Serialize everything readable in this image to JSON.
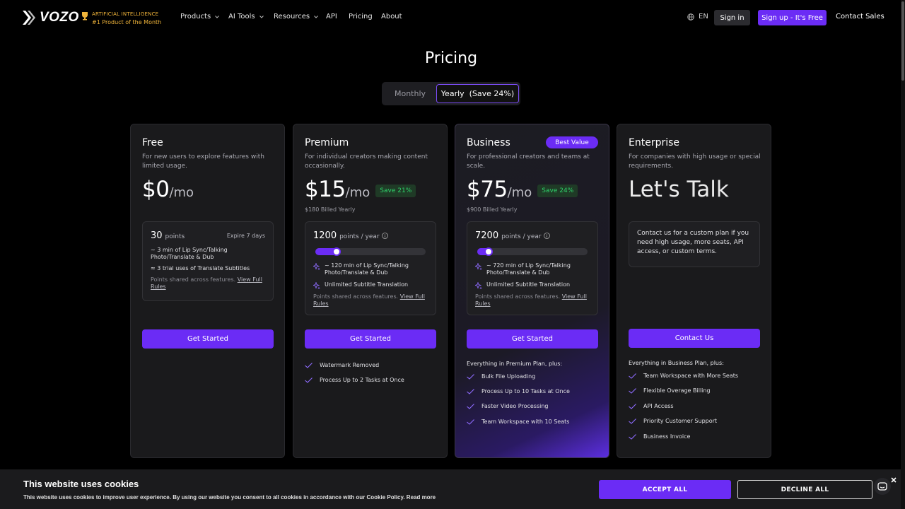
{
  "nav": {
    "brand": "VOZO",
    "award_line1": "ARTIFICIAL INTELLIGENCE",
    "award_line2": "#1 Product of the Month",
    "links": [
      "Products",
      "AI Tools",
      "Resources",
      "API",
      "Pricing",
      "About"
    ],
    "language": "EN",
    "sign_in": "Sign in",
    "sign_up": "Sign up - It's Free",
    "contact_sales": "Contact Sales"
  },
  "page": {
    "title": "Pricing",
    "toggle": {
      "monthly": "Monthly",
      "yearly": "Yearly  (Save 24%)",
      "selected": "yearly"
    }
  },
  "plans": {
    "free": {
      "name": "Free",
      "desc": "For new users to explore features with limited usage.",
      "price": "$0",
      "per": "/mo",
      "points": "30",
      "points_unit": "points",
      "expire": "Expire 7 days",
      "line1": "~ 3 min of Lip Sync/Talking Photo/Translate & Dub",
      "line2": "≈ 3 trial uses of Translate Subtitles",
      "shared": "Points shared across features.",
      "rules_link": "View Full Rules",
      "cta": "Get Started"
    },
    "premium": {
      "name": "Premium",
      "desc": "For individual creators making content occasionally.",
      "price": "$15",
      "per": "/mo",
      "save": "Save 21%",
      "billed": "$180 Billed Yearly",
      "points": "1200",
      "points_unit": "points / year",
      "slider_fraction": 0.19,
      "feature1": "~ 120 min of Lip Sync/Talking Photo/Translate & Dub",
      "feature2": "Unlimited Subtitle Translation",
      "shared": "Points shared across features.",
      "rules_link": "View Full Rules",
      "cta": "Get Started",
      "features": [
        "Watermark Removed",
        "Process Up to 2 Tasks at Once"
      ]
    },
    "business": {
      "name": "Business",
      "badge": "Best Value",
      "desc": "For professional creators and teams at scale.",
      "price": "$75",
      "per": "/mo",
      "save": "Save 24%",
      "billed": "$900 Billed Yearly",
      "points": "7200",
      "points_unit": "points / year",
      "slider_fraction": 0.1,
      "feature1": "~ 720 min of Lip Sync/Talking Photo/Translate & Dub",
      "feature2": "Unlimited Subtitle Translation",
      "shared": "Points shared across features.",
      "rules_link": "View Full Rules",
      "cta": "Get Started",
      "features_head": "Everything in Premium Plan, plus:",
      "features": [
        "Bulk File Uploading",
        "Process Up to 10 Tasks at Once",
        "Faster Video Processing",
        "Team Workspace with 10 Seats"
      ]
    },
    "enterprise": {
      "name": "Enterprise",
      "desc": "For companies with high usage or special requirements.",
      "headline": "Let's Talk",
      "contact_text": "Contact us for a custom plan if you need high usage, more seats, API access, or custom terms.",
      "cta": "Contact Us",
      "features_head": "Everything in Business Plan, plus:",
      "features": [
        "Team Workspace with More Seats",
        "Flexible Overage Billing",
        "API Access",
        "Priority Customer Support",
        "Business Invoice"
      ]
    }
  },
  "cookie": {
    "title": "This website uses cookies",
    "text": "This website uses cookies to improve user experience. By using our website you consent to all cookies in accordance with our Cookie Policy. Read more",
    "accept": "ACCEPT ALL",
    "decline": "DECLINE ALL"
  },
  "colors": {
    "accent": "#6b2cf5",
    "save_green": "#2fd06a",
    "award_gold": "#f0b43a"
  }
}
